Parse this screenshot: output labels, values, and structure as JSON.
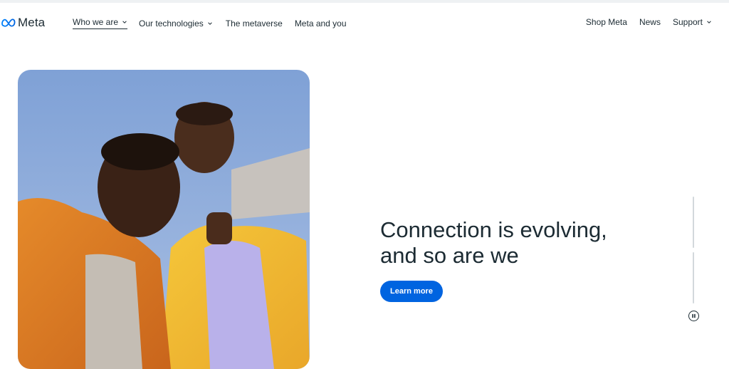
{
  "brand": {
    "name": "Meta",
    "logo_icon": "meta-infinity-icon",
    "accent_color": "#0064e0",
    "text_color": "#1c2b33"
  },
  "nav": {
    "left_items": [
      {
        "label": "Who we are",
        "has_dropdown": true,
        "active": true
      },
      {
        "label": "Our technologies",
        "has_dropdown": true,
        "active": false
      },
      {
        "label": "The metaverse",
        "has_dropdown": false,
        "active": false
      },
      {
        "label": "Meta and you",
        "has_dropdown": false,
        "active": false
      }
    ],
    "right_items": [
      {
        "label": "Shop Meta",
        "has_dropdown": false
      },
      {
        "label": "News",
        "has_dropdown": false
      },
      {
        "label": "Support",
        "has_dropdown": true
      }
    ]
  },
  "hero": {
    "image": "photo-two-men-selfie-orange-and-yellow-jackets",
    "headline_line1": "Connection is evolving,",
    "headline_line2": "and so are we",
    "cta_label": "Learn more"
  },
  "carousel": {
    "pause_icon": "pause-icon",
    "slides": [
      {
        "progress": 0
      },
      {
        "progress": 0
      }
    ]
  }
}
